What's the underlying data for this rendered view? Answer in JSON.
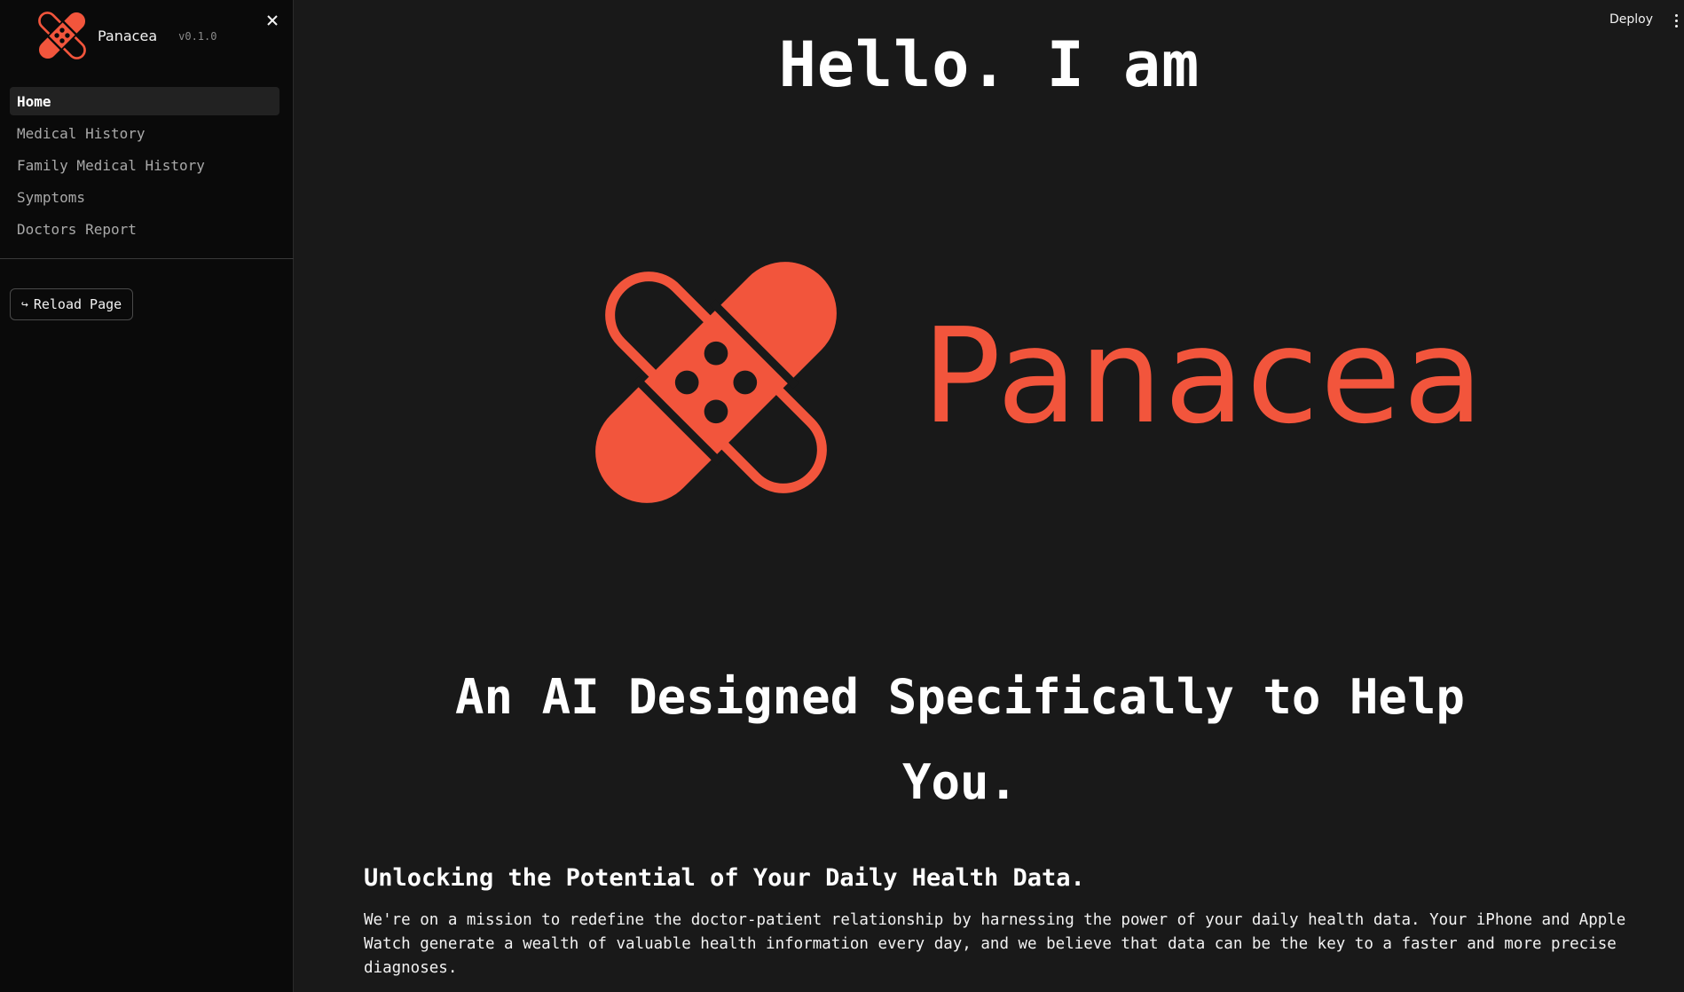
{
  "sidebar": {
    "brand_name": "Panacea",
    "version": "v0.1.0",
    "close_icon": "close-icon",
    "nav_items": [
      {
        "label": "Home",
        "active": true
      },
      {
        "label": "Medical History",
        "active": false
      },
      {
        "label": "Family Medical History",
        "active": false
      },
      {
        "label": "Symptoms",
        "active": false
      },
      {
        "label": "Doctors Report",
        "active": false
      }
    ],
    "reload_button": {
      "icon": "↪",
      "label": "Reload Page"
    }
  },
  "toolbar": {
    "deploy_label": "Deploy",
    "menu_icon": "more-vertical-icon"
  },
  "main": {
    "hero_title": "Hello. I am",
    "brand_text": "Panacea",
    "tagline": "An AI Designed Specifically to Help You.",
    "section_heading": "Unlocking the Potential of Your Daily Health Data.",
    "section_body": "We're on a mission to redefine the doctor-patient relationship by harnessing the power of your daily health data. Your iPhone and Apple Watch generate a wealth of valuable health information every day, and we believe that data can be the key to a faster and more precise diagnoses."
  },
  "colors": {
    "accent": "#f2553c",
    "background": "#191919",
    "sidebar_background": "#0a0a0a"
  }
}
